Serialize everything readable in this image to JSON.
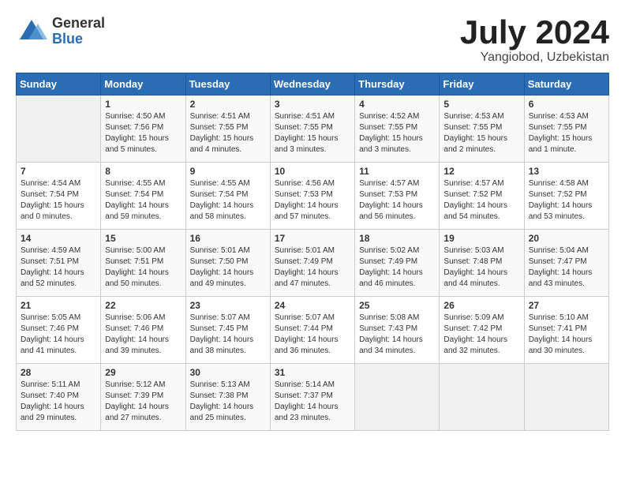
{
  "logo": {
    "general": "General",
    "blue": "Blue"
  },
  "title": {
    "month": "July 2024",
    "location": "Yangiobod, Uzbekistan"
  },
  "headers": [
    "Sunday",
    "Monday",
    "Tuesday",
    "Wednesday",
    "Thursday",
    "Friday",
    "Saturday"
  ],
  "weeks": [
    [
      {
        "day": "",
        "sunrise": "",
        "sunset": "",
        "daylight": ""
      },
      {
        "day": "1",
        "sunrise": "Sunrise: 4:50 AM",
        "sunset": "Sunset: 7:56 PM",
        "daylight": "Daylight: 15 hours and 5 minutes."
      },
      {
        "day": "2",
        "sunrise": "Sunrise: 4:51 AM",
        "sunset": "Sunset: 7:55 PM",
        "daylight": "Daylight: 15 hours and 4 minutes."
      },
      {
        "day": "3",
        "sunrise": "Sunrise: 4:51 AM",
        "sunset": "Sunset: 7:55 PM",
        "daylight": "Daylight: 15 hours and 3 minutes."
      },
      {
        "day": "4",
        "sunrise": "Sunrise: 4:52 AM",
        "sunset": "Sunset: 7:55 PM",
        "daylight": "Daylight: 15 hours and 3 minutes."
      },
      {
        "day": "5",
        "sunrise": "Sunrise: 4:53 AM",
        "sunset": "Sunset: 7:55 PM",
        "daylight": "Daylight: 15 hours and 2 minutes."
      },
      {
        "day": "6",
        "sunrise": "Sunrise: 4:53 AM",
        "sunset": "Sunset: 7:55 PM",
        "daylight": "Daylight: 15 hours and 1 minute."
      }
    ],
    [
      {
        "day": "7",
        "sunrise": "Sunrise: 4:54 AM",
        "sunset": "Sunset: 7:54 PM",
        "daylight": "Daylight: 15 hours and 0 minutes."
      },
      {
        "day": "8",
        "sunrise": "Sunrise: 4:55 AM",
        "sunset": "Sunset: 7:54 PM",
        "daylight": "Daylight: 14 hours and 59 minutes."
      },
      {
        "day": "9",
        "sunrise": "Sunrise: 4:55 AM",
        "sunset": "Sunset: 7:54 PM",
        "daylight": "Daylight: 14 hours and 58 minutes."
      },
      {
        "day": "10",
        "sunrise": "Sunrise: 4:56 AM",
        "sunset": "Sunset: 7:53 PM",
        "daylight": "Daylight: 14 hours and 57 minutes."
      },
      {
        "day": "11",
        "sunrise": "Sunrise: 4:57 AM",
        "sunset": "Sunset: 7:53 PM",
        "daylight": "Daylight: 14 hours and 56 minutes."
      },
      {
        "day": "12",
        "sunrise": "Sunrise: 4:57 AM",
        "sunset": "Sunset: 7:52 PM",
        "daylight": "Daylight: 14 hours and 54 minutes."
      },
      {
        "day": "13",
        "sunrise": "Sunrise: 4:58 AM",
        "sunset": "Sunset: 7:52 PM",
        "daylight": "Daylight: 14 hours and 53 minutes."
      }
    ],
    [
      {
        "day": "14",
        "sunrise": "Sunrise: 4:59 AM",
        "sunset": "Sunset: 7:51 PM",
        "daylight": "Daylight: 14 hours and 52 minutes."
      },
      {
        "day": "15",
        "sunrise": "Sunrise: 5:00 AM",
        "sunset": "Sunset: 7:51 PM",
        "daylight": "Daylight: 14 hours and 50 minutes."
      },
      {
        "day": "16",
        "sunrise": "Sunrise: 5:01 AM",
        "sunset": "Sunset: 7:50 PM",
        "daylight": "Daylight: 14 hours and 49 minutes."
      },
      {
        "day": "17",
        "sunrise": "Sunrise: 5:01 AM",
        "sunset": "Sunset: 7:49 PM",
        "daylight": "Daylight: 14 hours and 47 minutes."
      },
      {
        "day": "18",
        "sunrise": "Sunrise: 5:02 AM",
        "sunset": "Sunset: 7:49 PM",
        "daylight": "Daylight: 14 hours and 46 minutes."
      },
      {
        "day": "19",
        "sunrise": "Sunrise: 5:03 AM",
        "sunset": "Sunset: 7:48 PM",
        "daylight": "Daylight: 14 hours and 44 minutes."
      },
      {
        "day": "20",
        "sunrise": "Sunrise: 5:04 AM",
        "sunset": "Sunset: 7:47 PM",
        "daylight": "Daylight: 14 hours and 43 minutes."
      }
    ],
    [
      {
        "day": "21",
        "sunrise": "Sunrise: 5:05 AM",
        "sunset": "Sunset: 7:46 PM",
        "daylight": "Daylight: 14 hours and 41 minutes."
      },
      {
        "day": "22",
        "sunrise": "Sunrise: 5:06 AM",
        "sunset": "Sunset: 7:46 PM",
        "daylight": "Daylight: 14 hours and 39 minutes."
      },
      {
        "day": "23",
        "sunrise": "Sunrise: 5:07 AM",
        "sunset": "Sunset: 7:45 PM",
        "daylight": "Daylight: 14 hours and 38 minutes."
      },
      {
        "day": "24",
        "sunrise": "Sunrise: 5:07 AM",
        "sunset": "Sunset: 7:44 PM",
        "daylight": "Daylight: 14 hours and 36 minutes."
      },
      {
        "day": "25",
        "sunrise": "Sunrise: 5:08 AM",
        "sunset": "Sunset: 7:43 PM",
        "daylight": "Daylight: 14 hours and 34 minutes."
      },
      {
        "day": "26",
        "sunrise": "Sunrise: 5:09 AM",
        "sunset": "Sunset: 7:42 PM",
        "daylight": "Daylight: 14 hours and 32 minutes."
      },
      {
        "day": "27",
        "sunrise": "Sunrise: 5:10 AM",
        "sunset": "Sunset: 7:41 PM",
        "daylight": "Daylight: 14 hours and 30 minutes."
      }
    ],
    [
      {
        "day": "28",
        "sunrise": "Sunrise: 5:11 AM",
        "sunset": "Sunset: 7:40 PM",
        "daylight": "Daylight: 14 hours and 29 minutes."
      },
      {
        "day": "29",
        "sunrise": "Sunrise: 5:12 AM",
        "sunset": "Sunset: 7:39 PM",
        "daylight": "Daylight: 14 hours and 27 minutes."
      },
      {
        "day": "30",
        "sunrise": "Sunrise: 5:13 AM",
        "sunset": "Sunset: 7:38 PM",
        "daylight": "Daylight: 14 hours and 25 minutes."
      },
      {
        "day": "31",
        "sunrise": "Sunrise: 5:14 AM",
        "sunset": "Sunset: 7:37 PM",
        "daylight": "Daylight: 14 hours and 23 minutes."
      },
      {
        "day": "",
        "sunrise": "",
        "sunset": "",
        "daylight": ""
      },
      {
        "day": "",
        "sunrise": "",
        "sunset": "",
        "daylight": ""
      },
      {
        "day": "",
        "sunrise": "",
        "sunset": "",
        "daylight": ""
      }
    ]
  ]
}
